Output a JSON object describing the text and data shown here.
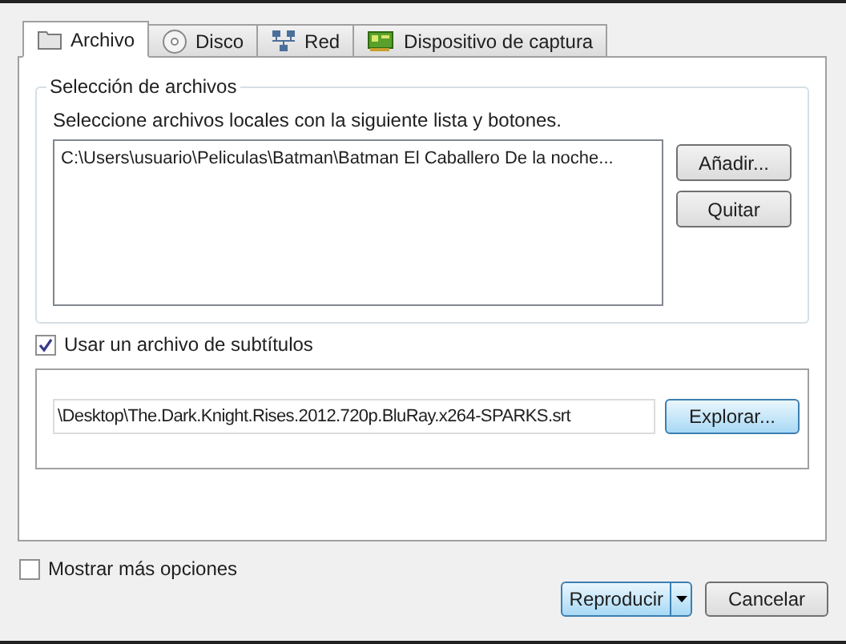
{
  "tabs": [
    {
      "label": "Archivo",
      "selected": true
    },
    {
      "label": "Disco",
      "selected": false
    },
    {
      "label": "Red",
      "selected": false
    },
    {
      "label": "Dispositivo de captura",
      "selected": false
    }
  ],
  "file_selection": {
    "title": "Selección de archivos",
    "instructions": "Seleccione archivos locales con la siguiente lista y botones.",
    "files": [
      "C:\\Users\\usuario\\Peliculas\\Batman\\Batman El Caballero De la noche..."
    ],
    "buttons": [
      "Añadir...",
      "Quitar"
    ]
  },
  "subtitles": {
    "label": "Usar un archivo de subtítulos",
    "checked": true,
    "path": "\\Desktop\\The.Dark.Knight.Rises.2012.720p.BluRay.x264-SPARKS.srt",
    "button": "Explorar..."
  },
  "more_options": {
    "label": "Mostrar más opciones",
    "checked": false
  },
  "buttons": {
    "play": "Reproducir",
    "cancel": "Cancelar"
  }
}
